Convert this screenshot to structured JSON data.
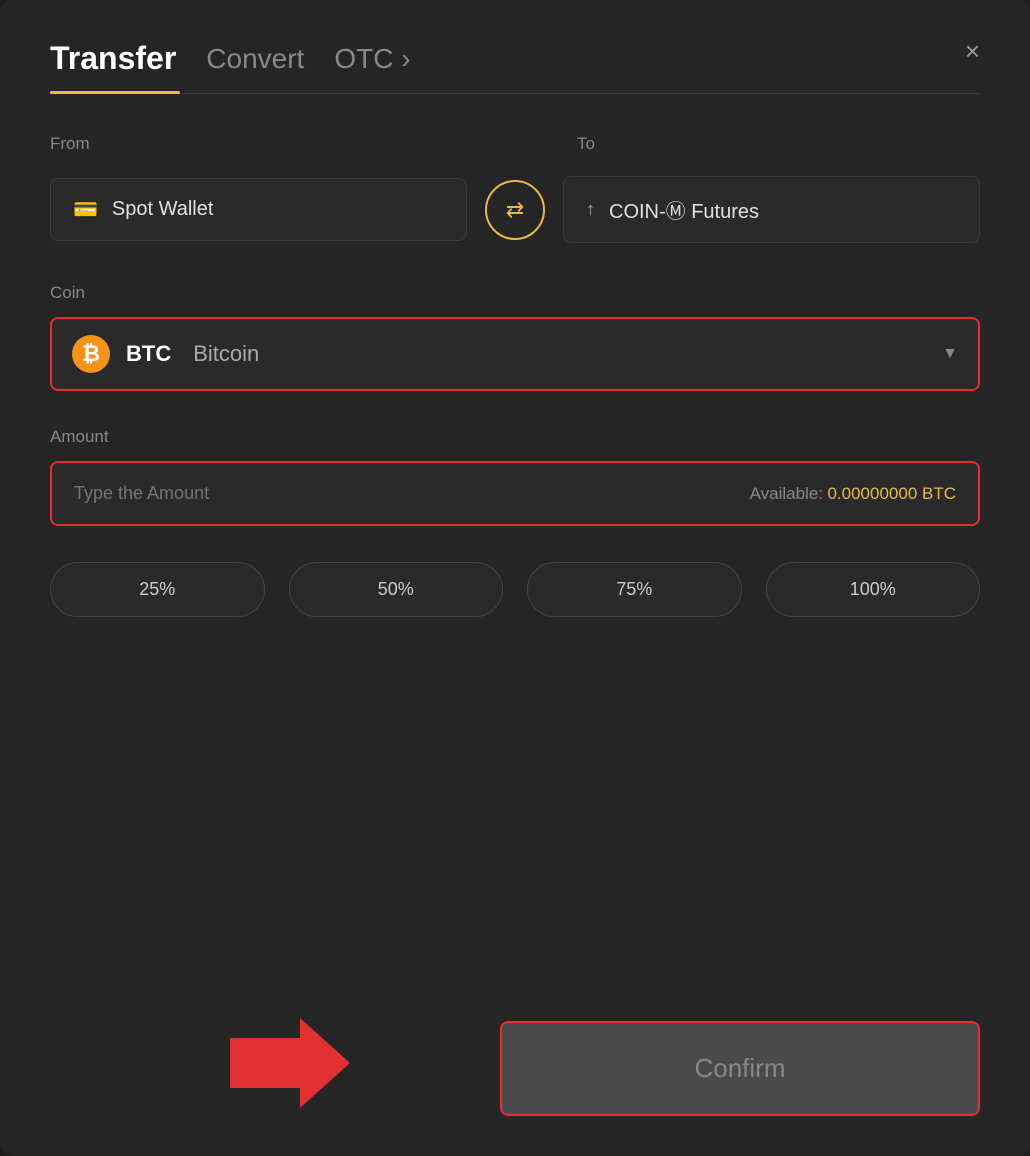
{
  "modal": {
    "title": "Transfer",
    "tabs": [
      {
        "id": "transfer",
        "label": "Transfer",
        "active": true
      },
      {
        "id": "convert",
        "label": "Convert",
        "active": false
      },
      {
        "id": "otc",
        "label": "OTC ›",
        "active": false
      }
    ],
    "close_label": "×"
  },
  "from": {
    "label": "From",
    "wallet_icon": "🪪",
    "wallet_name": "Spot Wallet"
  },
  "to": {
    "label": "To",
    "wallet_icon": "↑",
    "wallet_name": "COIN-Ⓜ Futures"
  },
  "swap_icon": "⇄",
  "coin": {
    "label": "Coin",
    "symbol": "BTC",
    "name": "Bitcoin",
    "dropdown_icon": "▼"
  },
  "amount": {
    "label": "Amount",
    "placeholder": "Type the Amount",
    "available_label": "Available:",
    "available_value": "0.00000000 BTC"
  },
  "percent_buttons": [
    {
      "label": "25%"
    },
    {
      "label": "50%"
    },
    {
      "label": "75%"
    },
    {
      "label": "100%"
    }
  ],
  "confirm_button": {
    "label": "Confirm"
  }
}
